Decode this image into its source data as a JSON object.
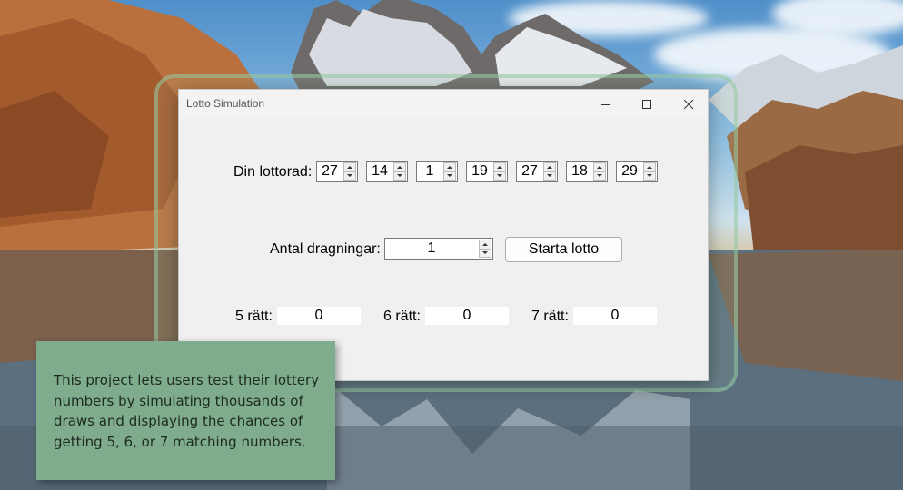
{
  "window": {
    "title": "Lotto Simulation",
    "controls": {
      "minimize_icon": "minimize-icon",
      "maximize_icon": "maximize-icon",
      "close_icon": "close-icon"
    }
  },
  "lottorad": {
    "label": "Din lottorad:",
    "numbers": [
      "27",
      "14",
      "1",
      "19",
      "27",
      "18",
      "29"
    ]
  },
  "dragningar": {
    "label": "Antal dragningar:",
    "value": "1"
  },
  "start_button": {
    "label": "Starta lotto"
  },
  "results": [
    {
      "label": "5 rätt:",
      "value": "0"
    },
    {
      "label": "6 rätt:",
      "value": "0"
    },
    {
      "label": "7 rätt:",
      "value": "0"
    }
  ],
  "caption": {
    "text": "This project lets users test their lottery numbers by simulating thousands of draws and displaying the chances of getting 5, 6, or 7 matching numbers."
  },
  "colors": {
    "caption_bg": "#7fac8c",
    "window_bg": "#f0f0f0",
    "glass_frame": "#96c8a0"
  }
}
